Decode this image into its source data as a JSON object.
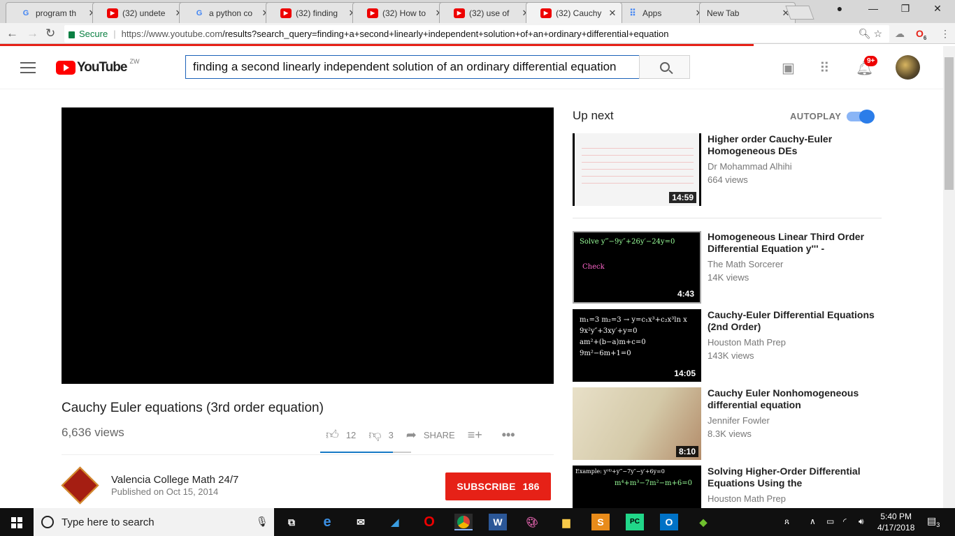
{
  "browser": {
    "tabs": [
      {
        "icon": "google-icon",
        "title": "program th"
      },
      {
        "icon": "youtube-icon",
        "title": "(32) undete"
      },
      {
        "icon": "google-icon",
        "title": "a python co"
      },
      {
        "icon": "youtube-icon",
        "title": "(32) finding"
      },
      {
        "icon": "youtube-icon",
        "title": "(32) How to"
      },
      {
        "icon": "youtube-icon",
        "title": "(32) use of"
      },
      {
        "icon": "youtube-icon",
        "title": "(32) Cauchy"
      },
      {
        "icon": "apps-icon",
        "title": "Apps"
      },
      {
        "icon": "none",
        "title": "New Tab"
      }
    ],
    "active_tab": 6,
    "secure_label": "Secure",
    "url_host": "https://www.youtube.com",
    "url_path": "/results?search_query=finding+a+second+linearly+independent+solution+of+an+ordinary+differential+equation",
    "extension_badge": "6"
  },
  "youtube": {
    "logo_text": "YouTube",
    "region": "ZW",
    "search_query": "finding a second linearly independent solution of an ordinary differential equation",
    "notification_count": "9+",
    "video": {
      "title": "Cauchy Euler equations (3rd order equation)",
      "views": "6,636 views",
      "likes": "12",
      "dislikes": "3",
      "share_label": "SHARE",
      "like_ratio": 0.8
    },
    "channel": {
      "name": "Valencia College Math 24/7",
      "published": "Published on Oct 15, 2014",
      "subscribe_label": "SUBSCRIBE",
      "subscribers": "186"
    },
    "up_next_label": "Up next",
    "autoplay_label": "AUTOPLAY",
    "autoplay_on": true,
    "suggestions": [
      {
        "title": "Higher order Cauchy-Euler Homogeneous DEs",
        "channel": "Dr Mohammad Alhihi",
        "views": "664 views",
        "duration": "14:59"
      },
      {
        "title": "Homogeneous Linear Third Order Differential Equation y''' -",
        "channel": "The Math Sorcerer",
        "views": "14K views",
        "duration": "4:43"
      },
      {
        "title": "Cauchy-Euler Differential Equations (2nd Order)",
        "channel": "Houston Math Prep",
        "views": "143K views",
        "duration": "14:05"
      },
      {
        "title": "Cauchy Euler Nonhomogeneous differential equation",
        "channel": "Jennifer Fowler",
        "views": "8.3K views",
        "duration": "8:10"
      },
      {
        "title": "Solving Higher-Order Differential Equations Using the",
        "channel": "Houston Math Prep",
        "views": "",
        "duration": ""
      }
    ]
  },
  "taskbar": {
    "search_placeholder": "Type here to search",
    "time": "5:40 PM",
    "date": "4/17/2018",
    "notifications": "3"
  }
}
